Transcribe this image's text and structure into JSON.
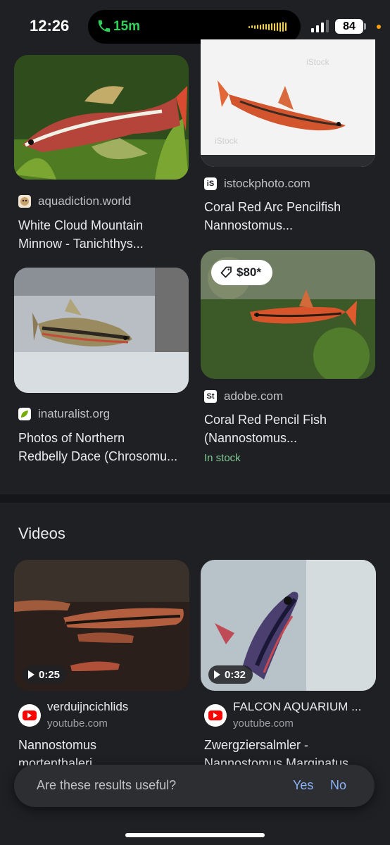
{
  "status_bar": {
    "time": "12:26",
    "call_duration": "15m",
    "battery": "84"
  },
  "image_results": [
    {
      "source": "aquadiction.world",
      "title_lines": [
        "White Cloud Mountain",
        "Minnow - Tanichthys..."
      ],
      "favicon": "aquadiction-icon"
    },
    {
      "source": "istockphoto.com",
      "title_lines": [
        "Coral Red Arc Pencilfish",
        "Nannostomus..."
      ],
      "favicon": "istock-icon",
      "favicon_text": "iS"
    },
    {
      "source": "inaturalist.org",
      "title_lines": [
        "Photos of Northern",
        "Redbelly Dace (Chrosomu..."
      ],
      "favicon": "inaturalist-icon"
    },
    {
      "source": "adobe.com",
      "title_lines": [
        "Coral Red Pencil Fish",
        "(Nannostomus..."
      ],
      "favicon": "adobe-stock-icon",
      "favicon_text": "St",
      "price": "$80*",
      "stock_status": "In stock"
    }
  ],
  "videos": {
    "heading": "Videos",
    "items": [
      {
        "duration": "0:25",
        "channel": "verduijncichlids",
        "platform": "youtube.com",
        "title_lines": [
          "Nannostomus",
          "mortenthaleri"
        ]
      },
      {
        "duration": "0:32",
        "channel": "FALCON AQUARIUM ...",
        "platform": "youtube.com",
        "title_lines": [
          "Zwergziersalmler -",
          "Nannostomus Marginatus ..."
        ]
      }
    ]
  },
  "feedback": {
    "question": "Are these results useful?",
    "yes": "Yes",
    "no": "No"
  },
  "colors": {
    "background": "#1f2023",
    "link_blue": "#8ab4f8",
    "stock_green": "#81c995",
    "call_green": "#30d158"
  }
}
